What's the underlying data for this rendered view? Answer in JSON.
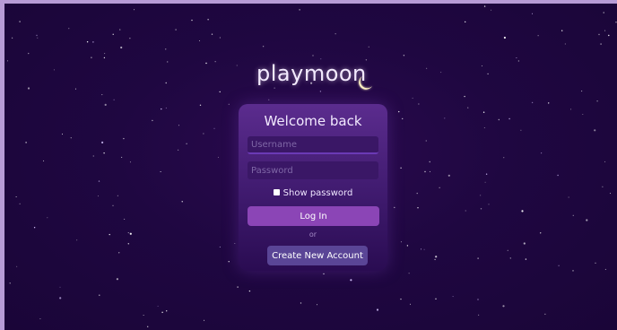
{
  "brand": {
    "name": "playmoon",
    "moon_icon": "crescent-moon-icon"
  },
  "login": {
    "title": "Welcome back",
    "username_placeholder": "Username",
    "password_placeholder": "Password",
    "show_password_label": "Show password",
    "login_button": "Log In",
    "divider": "or",
    "create_account_button": "Create New Account"
  },
  "colors": {
    "background": "#1f0741",
    "card": "#3f1a6e",
    "primary_button": "#8b45b6",
    "secondary_button": "#5a4596",
    "frame": "#b79bd6"
  }
}
